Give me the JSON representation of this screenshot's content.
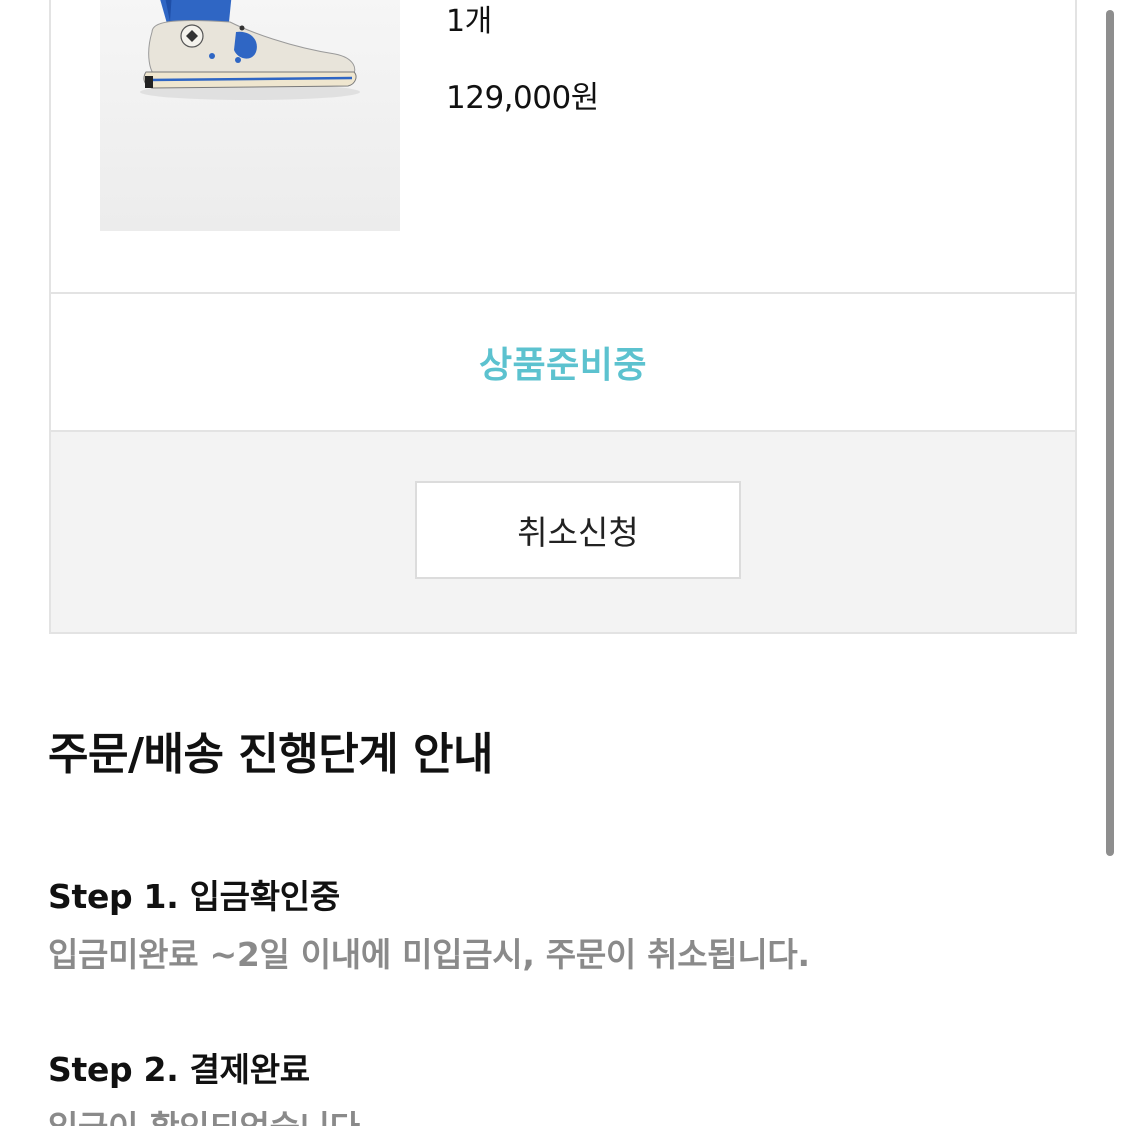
{
  "product": {
    "quantity": "1개",
    "price": "129,000원",
    "image": "high-top-sneaker-image"
  },
  "order_status": {
    "label": "상품준비중",
    "color": "#5cc2cf"
  },
  "actions": {
    "cancel_label": "취소신청"
  },
  "guide": {
    "title": "주문/배송 진행단계 안내",
    "steps": [
      {
        "title": "Step 1. 입금확인중",
        "description": "입금미완료 ~2일 이내에 미입금시, 주문이 취소됩니다."
      },
      {
        "title": "Step 2. 결제완료",
        "description": "입금이 확인되었습니다."
      }
    ]
  }
}
